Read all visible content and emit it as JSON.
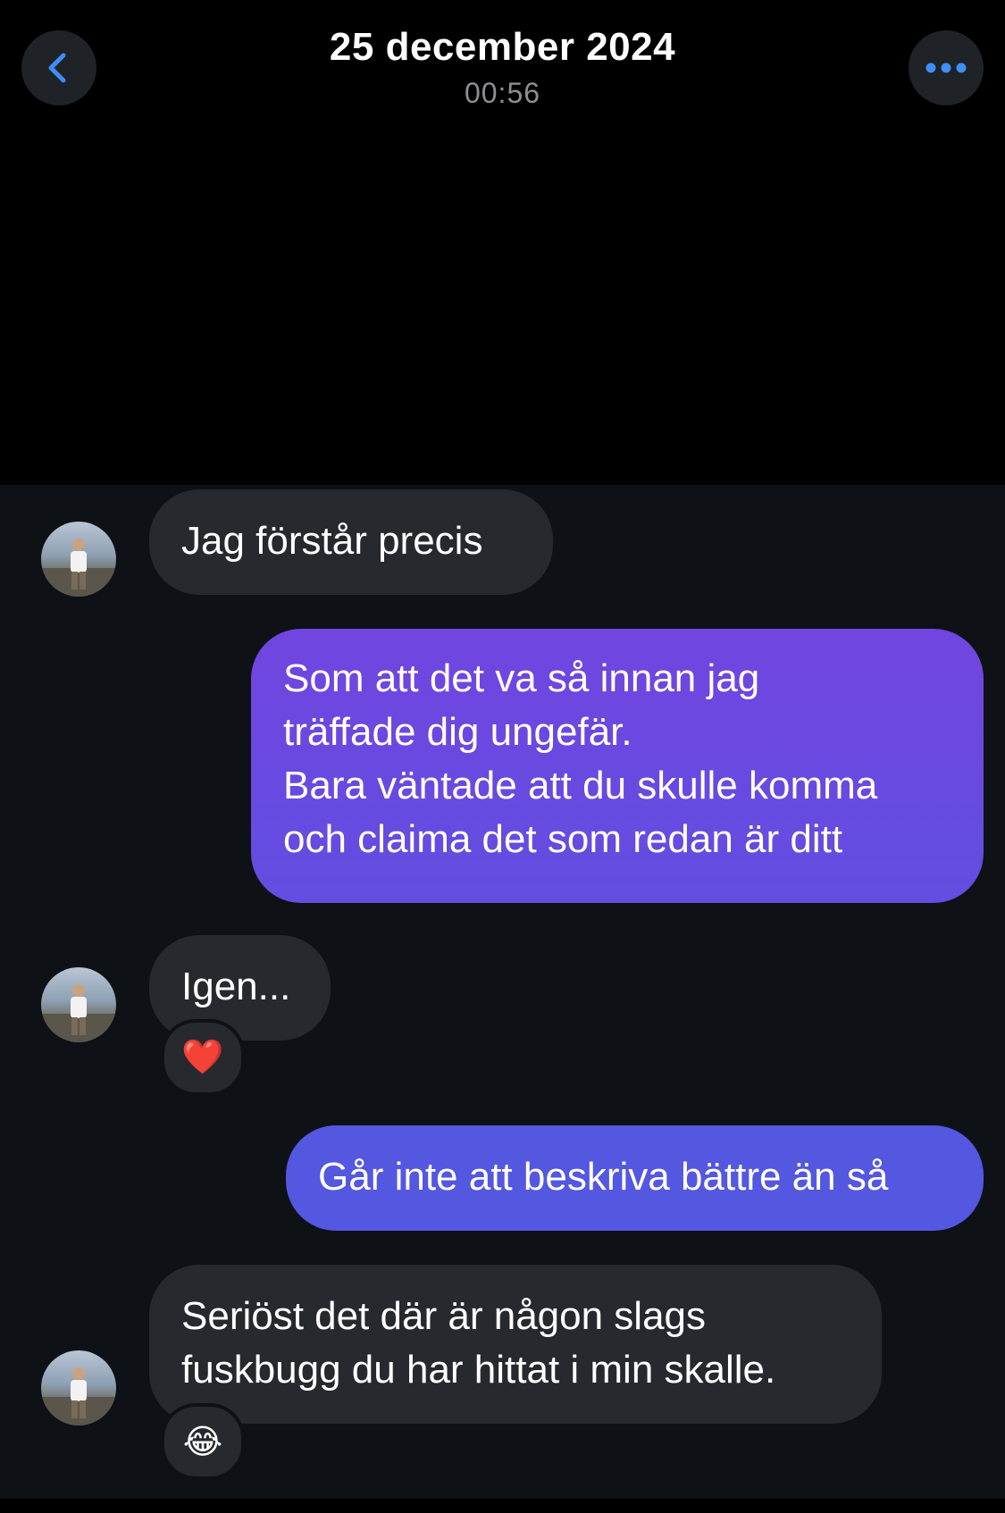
{
  "header": {
    "date": "25 december 2024",
    "time": "00:56",
    "back_icon": "chevron-left-icon",
    "more_icon": "ellipsis-icon",
    "accent_color": "#3e8ef7"
  },
  "messages": [
    {
      "direction": "incoming",
      "text": "Jag förstår precis"
    },
    {
      "direction": "outgoing",
      "text": "Som att det va så innan jag\nträffade dig ungefär.\nBara väntade att du skulle komma\noch claima det som redan är ditt"
    },
    {
      "direction": "incoming",
      "text": "Igen...",
      "reaction": "❤️"
    },
    {
      "direction": "outgoing",
      "text": "Går inte att beskriva bättre än så"
    },
    {
      "direction": "incoming",
      "text": "Seriöst det där är någon slags\nfuskbugg du har hittat i min skalle.",
      "reaction": "😂"
    }
  ],
  "colors": {
    "chat_background": "#0e1116",
    "incoming_bubble": "#26292e",
    "outgoing_gradient_top": "#7145e0",
    "outgoing_bottom": "#5457e0"
  }
}
